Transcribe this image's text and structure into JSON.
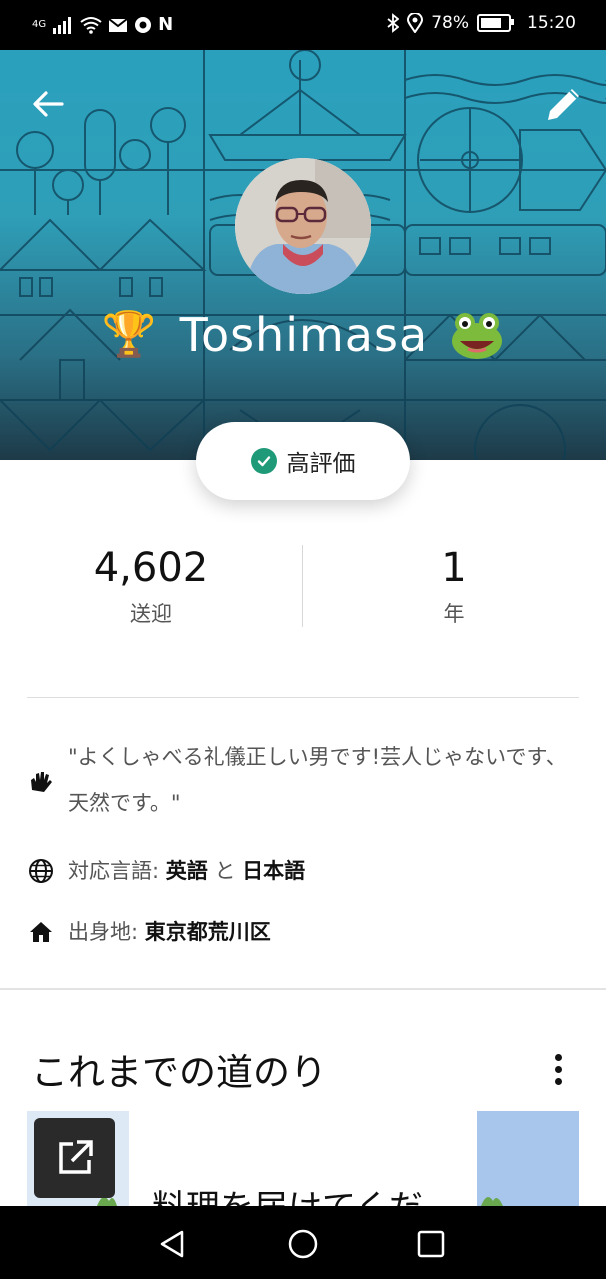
{
  "status_bar": {
    "network": "4G",
    "battery_percent": "78%",
    "battery_level": 0.78,
    "time": "15:20",
    "icons_left": [
      "signal-icon",
      "wifi-icon",
      "mail-icon",
      "chrome-icon",
      "n-icon"
    ],
    "icons_right": [
      "bluetooth-icon",
      "location-icon",
      "battery-icon"
    ]
  },
  "header": {
    "back_icon": "arrow-left-icon",
    "edit_icon": "pencil-icon",
    "name": "Toshimasa",
    "trophy_emoji": "🏆",
    "frog_emoji": "🐸"
  },
  "badge": {
    "label": "高評価",
    "icon": "check-circle-icon",
    "color": "#1f9a78"
  },
  "stats": [
    {
      "value": "4,602",
      "label": "送迎"
    },
    {
      "value": "1",
      "label": "年"
    }
  ],
  "about": {
    "bio": "\"よくしゃべる礼儀正しい男です!芸人じゃないです、天然です。\"",
    "languages_label": "対応言語: ",
    "language_1": "英語",
    "language_conj": " と ",
    "language_2": "日本語",
    "hometown_label": "出身地: ",
    "hometown": "東京都荒川区"
  },
  "journey": {
    "title": "これまでの道のり",
    "card_title": "料理を届けてくだ"
  }
}
